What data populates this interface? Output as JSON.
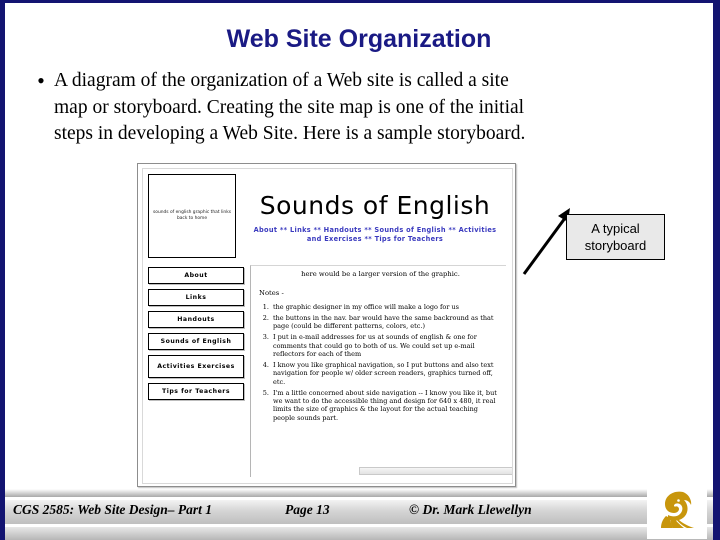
{
  "slide": {
    "title": "Web Site Organization",
    "border_color": "#131471",
    "title_color": "#1a1a84"
  },
  "bullet": {
    "marker": "•",
    "lines": [
      "A diagram of the organization of a Web site is called a site",
      "map or storyboard.  Creating the site map is one of the initial",
      "steps in developing a Web Site.  Here is a sample storyboard."
    ]
  },
  "callout": {
    "line1": "A typical",
    "line2": "storyboard",
    "arrow": "diagonal-arrow-up-left"
  },
  "storyboard": {
    "logo_placeholder": "sounds of english graphic that links back to home",
    "site_title": "Sounds of English",
    "nav_line1": "About ** Links ** Handouts ** Sounds of English ** Activities",
    "nav_line2": "and Exercises ** Tips for Teachers",
    "nav_color": "#3b3bbf",
    "buttons": [
      {
        "label": "About",
        "two_line": false
      },
      {
        "label": "Links",
        "two_line": false
      },
      {
        "label": "Handouts",
        "two_line": false
      },
      {
        "label": "Sounds of English",
        "two_line": false
      },
      {
        "label": "Activities Exercises",
        "two_line": true
      },
      {
        "label": "Tips for Teachers",
        "two_line": false
      }
    ],
    "graphic_note": "here would be a larger version of the graphic.",
    "notes_label": "Notes -",
    "notes": [
      "the graphic designer in my office will make a logo for us",
      "the buttons in the nav. bar would have the same backround as that page (could be different patterns, colors, etc.)",
      "I put in e-mail addresses for us at sounds of english & one for comments that could go to both of us. We could set up e-mail reflectors for each of them",
      "I know you like graphical navigation, so I put buttons and also text navigation for people w/ older screen readers, graphics turned off, etc.",
      "I'm a little concerned about side navigation -- I know you like it, but we want to do the accessible thing and design for 640 x 480, it real limits the size of graphics & the layout for the actual teaching people sounds part."
    ]
  },
  "footer": {
    "course": "CGS 2585: Web Site Design– Part 1",
    "page": "Page 13",
    "copyright": "© Dr. Mark Llewellyn",
    "logo_name": "ucf-pegasus-logo",
    "logo_color": "#c8960c"
  }
}
